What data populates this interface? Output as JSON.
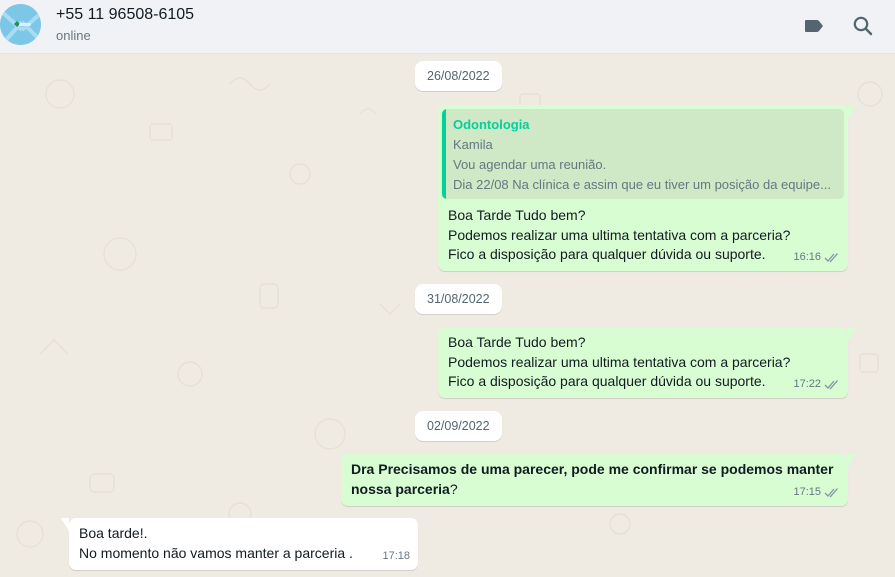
{
  "header": {
    "contact_name": "+55 11 96508-6105",
    "status": "online",
    "icons": [
      "label-icon",
      "search-icon"
    ]
  },
  "colors": {
    "outgoing_bubble": "#d9fdd3",
    "incoming_bubble": "#ffffff",
    "quote_accent": "#06cf9c",
    "chat_background": "#efeae2"
  },
  "dates": [
    "26/08/2022",
    "31/08/2022",
    "02/09/2022"
  ],
  "messages": [
    {
      "direction": "out",
      "quote": {
        "title": "Odontologia",
        "lines": [
          "Kamila",
          "Vou agendar uma reunião.",
          "Dia 22/08 Na clínica e assim que eu tiver um posição da equipe..."
        ]
      },
      "lines": [
        "Boa Tarde Tudo bem?",
        "Podemos realizar uma ultima tentativa com a parceria?",
        "Fico a disposição para qualquer dúvida ou suporte."
      ],
      "time": "16:16",
      "read_status": "double-check"
    },
    {
      "direction": "out",
      "lines": [
        "Boa Tarde Tudo bem?",
        "Podemos realizar uma ultima tentativa com a parceria?",
        "Fico a disposição para qualquer dúvida ou suporte."
      ],
      "time": "17:22",
      "read_status": "double-check"
    },
    {
      "direction": "out",
      "bold_text_line1": "Dra Precisamos de uma parecer, pode me confirmar se podemos  manter",
      "bold_text_line2": "nossa parceria",
      "trailing_text": "?",
      "time": "17:15",
      "read_status": "double-check"
    },
    {
      "direction": "in",
      "lines": [
        "Boa tarde!.",
        "No momento não vamos manter a parceria ."
      ],
      "time": "17:18"
    }
  ]
}
